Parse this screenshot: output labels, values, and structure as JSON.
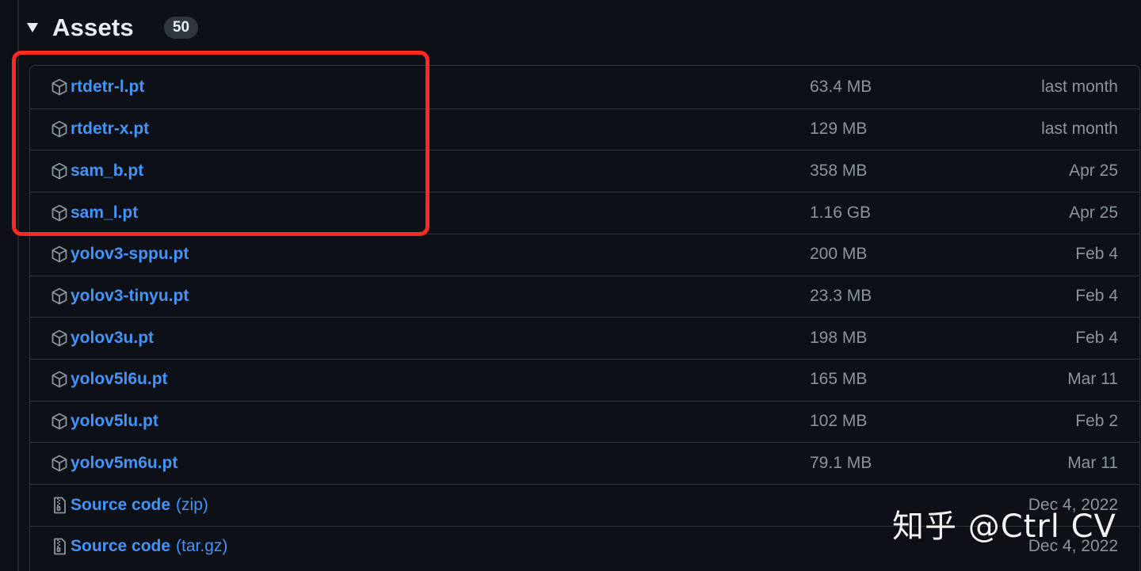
{
  "header": {
    "title": "Assets",
    "count": "50"
  },
  "assets": [
    {
      "name": "rtdetr-l.pt",
      "suffix": "",
      "size": "63.4 MB",
      "date": "last month",
      "icon": "package-icon"
    },
    {
      "name": "rtdetr-x.pt",
      "suffix": "",
      "size": "129 MB",
      "date": "last month",
      "icon": "package-icon"
    },
    {
      "name": "sam_b.pt",
      "suffix": "",
      "size": "358 MB",
      "date": "Apr 25",
      "icon": "package-icon"
    },
    {
      "name": "sam_l.pt",
      "suffix": "",
      "size": "1.16 GB",
      "date": "Apr 25",
      "icon": "package-icon"
    },
    {
      "name": "yolov3-sppu.pt",
      "suffix": "",
      "size": "200 MB",
      "date": "Feb 4",
      "icon": "package-icon"
    },
    {
      "name": "yolov3-tinyu.pt",
      "suffix": "",
      "size": "23.3 MB",
      "date": "Feb 4",
      "icon": "package-icon"
    },
    {
      "name": "yolov3u.pt",
      "suffix": "",
      "size": "198 MB",
      "date": "Feb 4",
      "icon": "package-icon"
    },
    {
      "name": "yolov5l6u.pt",
      "suffix": "",
      "size": "165 MB",
      "date": "Mar 11",
      "icon": "package-icon"
    },
    {
      "name": "yolov5lu.pt",
      "suffix": "",
      "size": "102 MB",
      "date": "Feb 2",
      "icon": "package-icon"
    },
    {
      "name": "yolov5m6u.pt",
      "suffix": "",
      "size": "79.1 MB",
      "date": "Mar 11",
      "icon": "package-icon"
    },
    {
      "name": "Source code",
      "suffix": "(zip)",
      "size": "",
      "date": "Dec 4, 2022",
      "icon": "file-zip-icon"
    },
    {
      "name": "Source code",
      "suffix": "(tar.gz)",
      "size": "",
      "date": "Dec 4, 2022",
      "icon": "file-zip-icon"
    }
  ],
  "watermark": "知乎 @Ctrl CV",
  "colors": {
    "background": "#0d1117",
    "link": "#4493f8",
    "muted": "#8b949e",
    "border": "#30363d",
    "highlight": "#ff2a1f"
  }
}
